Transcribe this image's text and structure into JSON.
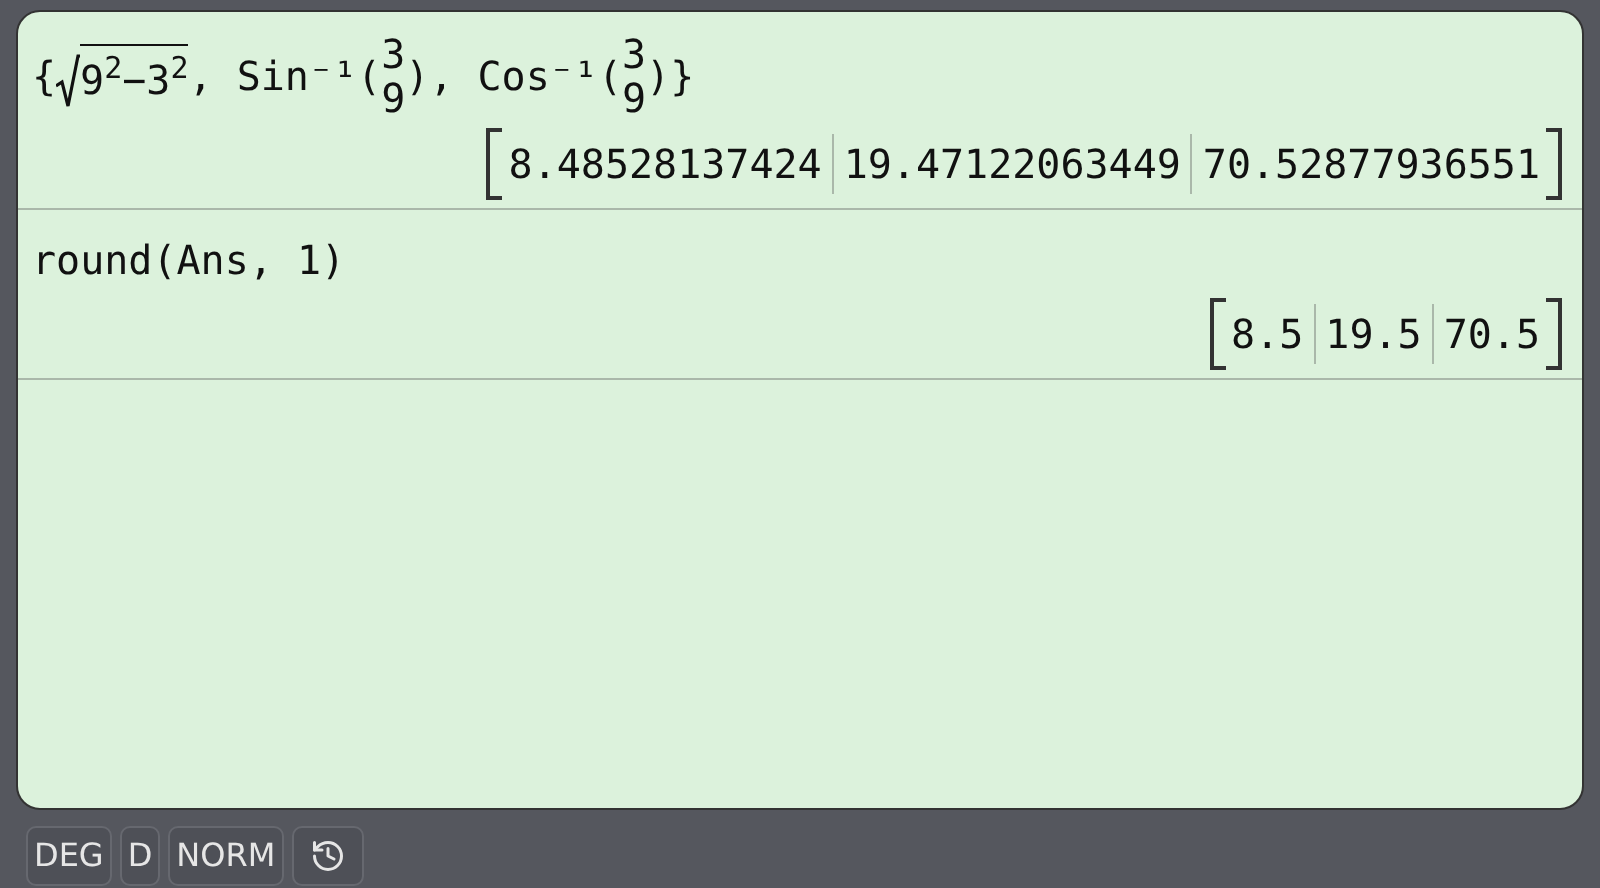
{
  "entries": [
    {
      "input": [
        {
          "kind": "text",
          "text": "{"
        },
        {
          "kind": "sqrt",
          "children": [
            {
              "kind": "text",
              "text": "9"
            },
            {
              "kind": "sup",
              "text": "2"
            },
            {
              "kind": "text",
              "text": "−3"
            },
            {
              "kind": "sup",
              "text": "2"
            }
          ]
        },
        {
          "kind": "text",
          "text": ", Sin⁻¹("
        },
        {
          "kind": "frac",
          "num": "3",
          "den": "9"
        },
        {
          "kind": "text",
          "text": "), Cos⁻¹("
        },
        {
          "kind": "frac",
          "num": "3",
          "den": "9"
        },
        {
          "kind": "text",
          "text": ")}"
        }
      ],
      "result": [
        "8.48528137424",
        "19.47122063449",
        "70.52877936551"
      ]
    },
    {
      "input": [
        {
          "kind": "text",
          "text": "round(Ans, 1)"
        }
      ],
      "result": [
        "8.5",
        "19.5",
        "70.5"
      ]
    }
  ],
  "status_bar": [
    {
      "kind": "text",
      "label": "DEG"
    },
    {
      "kind": "text",
      "label": "D"
    },
    {
      "kind": "text",
      "label": "NORM"
    },
    {
      "kind": "history"
    }
  ]
}
